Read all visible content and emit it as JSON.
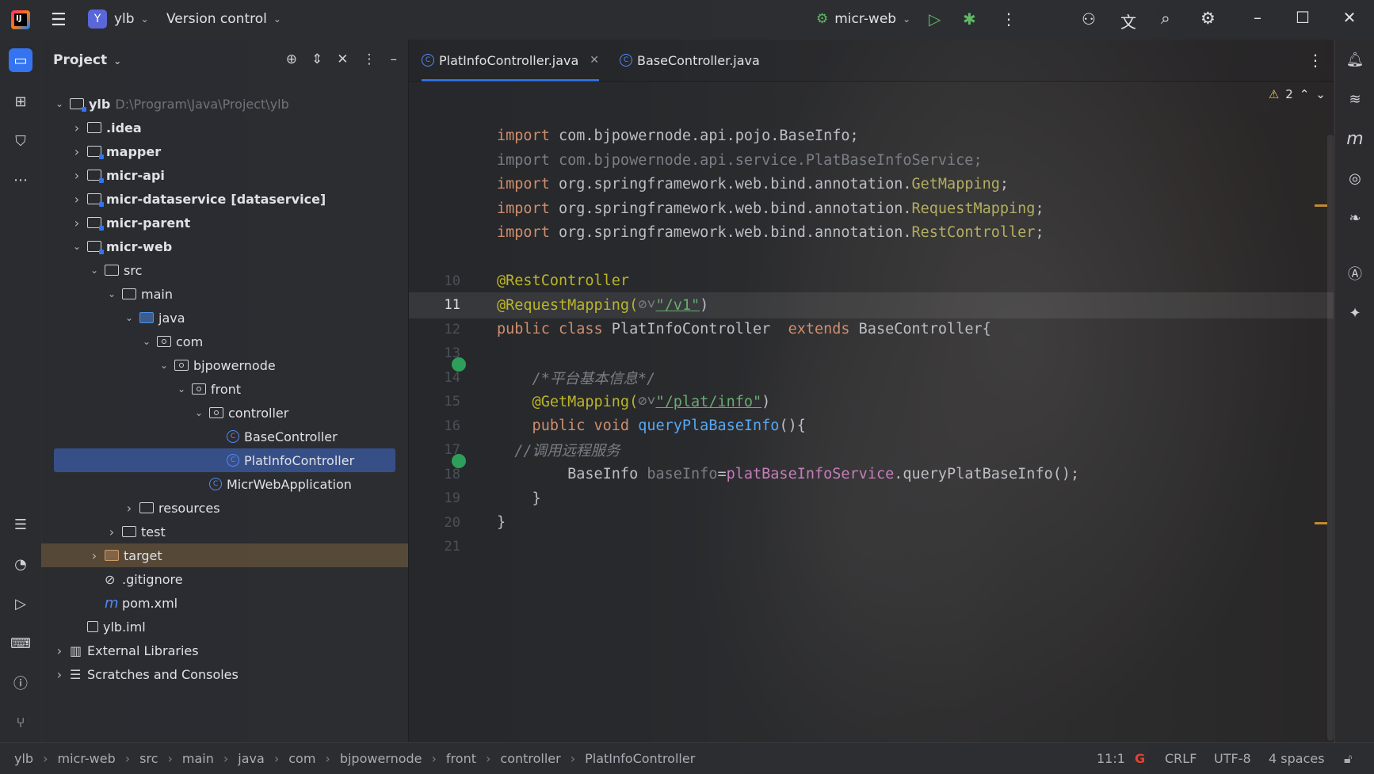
{
  "titlebar": {
    "project_badge": "Y",
    "project_name": "ylb",
    "vcs_label": "Version control",
    "run_config": "micr-web"
  },
  "project_panel": {
    "title": "Project",
    "tree": [
      {
        "label": "ylb",
        "extra": "D:\\Program\\Java\\Project\\ylb",
        "arrow": "open",
        "icon": "module-folder"
      },
      {
        "label": ".idea",
        "arrow": "closed",
        "icon": "folder"
      },
      {
        "label": "mapper",
        "arrow": "closed",
        "icon": "module-folder"
      },
      {
        "label": "micr-api",
        "arrow": "closed",
        "icon": "module-folder"
      },
      {
        "label": "micr-dataservice",
        "extra": "[dataservice]",
        "arrow": "closed",
        "icon": "module-folder"
      },
      {
        "label": "micr-parent",
        "arrow": "closed",
        "icon": "module-folder"
      },
      {
        "label": "micr-web",
        "arrow": "open",
        "icon": "module-folder"
      },
      {
        "label": "src",
        "arrow": "open",
        "icon": "folder"
      },
      {
        "label": "main",
        "arrow": "open",
        "icon": "folder"
      },
      {
        "label": "java",
        "arrow": "open",
        "icon": "source-folder"
      },
      {
        "label": "com",
        "arrow": "open",
        "icon": "package"
      },
      {
        "label": "bjpowernode",
        "arrow": "open",
        "icon": "package"
      },
      {
        "label": "front",
        "arrow": "open",
        "icon": "package"
      },
      {
        "label": "controller",
        "arrow": "open",
        "icon": "package"
      },
      {
        "label": "BaseController",
        "arrow": "none",
        "icon": "class"
      },
      {
        "label": "PlatInfoController",
        "arrow": "none",
        "icon": "class",
        "selected": true
      },
      {
        "label": "MicrWebApplication",
        "arrow": "none",
        "icon": "spring-class"
      },
      {
        "label": "resources",
        "arrow": "closed",
        "icon": "resources-folder"
      },
      {
        "label": "test",
        "arrow": "closed",
        "icon": "folder"
      },
      {
        "label": "target",
        "arrow": "closed",
        "icon": "target-folder"
      },
      {
        "label": ".gitignore",
        "arrow": "none",
        "icon": "ignore-file"
      },
      {
        "label": "pom.xml",
        "arrow": "none",
        "icon": "maven-file"
      },
      {
        "label": "ylb.iml",
        "arrow": "none",
        "icon": "iml-file"
      },
      {
        "label": "External Libraries",
        "arrow": "closed",
        "icon": "library"
      },
      {
        "label": "Scratches and Consoles",
        "arrow": "closed",
        "icon": "scratches"
      }
    ]
  },
  "tabs": [
    {
      "label": "PlatInfoController.java",
      "active": true
    },
    {
      "label": "BaseController.java",
      "active": false
    }
  ],
  "editor": {
    "warning_count": "2",
    "lines": [
      {
        "num": "",
        "tokens": [
          [
            "kw",
            "import "
          ],
          [
            "cls",
            "com.bjpowernode.api.pojo.BaseInfo;"
          ]
        ]
      },
      {
        "num": "",
        "tokens": [
          [
            "dim",
            "import com.bjpowernode.api.service.PlatBaseInfoService;"
          ]
        ]
      },
      {
        "num": "",
        "tokens": [
          [
            "kw",
            "import "
          ],
          [
            "cls",
            "org.springframework.web.bind.annotation."
          ],
          [
            "an",
            "GetMapping"
          ],
          [
            "cls",
            ";"
          ]
        ]
      },
      {
        "num": "",
        "tokens": [
          [
            "kw",
            "import "
          ],
          [
            "cls",
            "org.springframework.web.bind.annotation."
          ],
          [
            "an",
            "RequestMapping"
          ],
          [
            "cls",
            ";"
          ]
        ]
      },
      {
        "num": "",
        "tokens": [
          [
            "kw",
            "import "
          ],
          [
            "cls",
            "org.springframework.web.bind.annotation."
          ],
          [
            "an",
            "RestController"
          ],
          [
            "cls",
            ";"
          ]
        ]
      },
      {
        "num": "",
        "tokens": []
      },
      {
        "num": "10",
        "tokens": [
          [
            "ann2",
            "@RestController"
          ]
        ]
      },
      {
        "num": "11",
        "tokens": [
          [
            "ann2",
            "@RequestMapping("
          ],
          [
            "dim",
            "⊘˅"
          ],
          [
            "str",
            "\"/v1\""
          ],
          [
            "cls",
            ")"
          ]
        ],
        "current": true
      },
      {
        "num": "12",
        "tokens": [
          [
            "kw",
            "public class "
          ],
          [
            "cls",
            "PlatInfoController  "
          ],
          [
            "kw",
            "extends "
          ],
          [
            "cls",
            "BaseController{"
          ]
        ]
      },
      {
        "num": "13",
        "tokens": []
      },
      {
        "num": "14",
        "tokens": [
          [
            "cmt",
            "    /*平台基本信息*/"
          ]
        ]
      },
      {
        "num": "15",
        "tokens": [
          [
            "ann2",
            "    @GetMapping("
          ],
          [
            "dim",
            "⊘˅"
          ],
          [
            "str",
            "\"/plat/info\""
          ],
          [
            "cls",
            ")"
          ]
        ]
      },
      {
        "num": "16",
        "tokens": [
          [
            "kw",
            "    public void "
          ],
          [
            "fn",
            "queryPlaBaseInfo"
          ],
          [
            "cls",
            "(){"
          ]
        ]
      },
      {
        "num": "17",
        "tokens": [
          [
            "cmt",
            "  //调用远程服务"
          ]
        ]
      },
      {
        "num": "18",
        "tokens": [
          [
            "cls",
            "        BaseInfo "
          ],
          [
            "dim",
            "baseInfo"
          ],
          [
            "cls",
            "="
          ],
          [
            "fld",
            "platBaseInfoService"
          ],
          [
            "cls",
            ".queryPlatBaseInfo();"
          ]
        ]
      },
      {
        "num": "19",
        "tokens": [
          [
            "cls",
            "    }"
          ]
        ]
      },
      {
        "num": "20",
        "tokens": [
          [
            "cls",
            "}"
          ]
        ]
      },
      {
        "num": "21",
        "tokens": []
      }
    ]
  },
  "statusbar": {
    "breadcrumbs": [
      "ylb",
      "micr-web",
      "src",
      "main",
      "java",
      "com",
      "bjpowernode",
      "front",
      "controller",
      "PlatInfoController"
    ],
    "position": "11:1",
    "line_sep": "CRLF",
    "encoding": "UTF-8",
    "indent": "4 spaces"
  }
}
